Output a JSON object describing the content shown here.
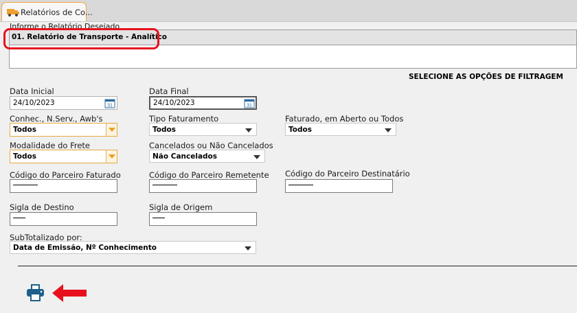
{
  "tab": {
    "title": "Relatórios de Co...",
    "icon": "truck-icon"
  },
  "report": {
    "hidden_label": "Informe o Relatório Desejado",
    "selected": "01. Relatório de Transporte - Analítico"
  },
  "filter_title": "SELECIONE AS OPÇÕES DE FILTRAGEM",
  "fields": {
    "data_inicial": {
      "label": "Data Inicial",
      "value": "24/10/2023"
    },
    "data_final": {
      "label": "Data Final",
      "value": "24/10/2023"
    },
    "conhec": {
      "label": "Conhec., N.Serv., Awb's",
      "value": "Todos"
    },
    "tipo_faturamento": {
      "label": "Tipo Faturamento",
      "value": "Todos"
    },
    "faturado": {
      "label": "Faturado, em Aberto ou Todos",
      "value": "Todos"
    },
    "modalidade": {
      "label": "Modalidade do Frete",
      "value": "Todos"
    },
    "cancelados": {
      "label": "Cancelados ou Não Cancelados",
      "value": "Não Cancelados"
    },
    "parceiro_faturado": {
      "label": "Código do Parceiro Faturado"
    },
    "parceiro_remetente": {
      "label": "Código do Parceiro Remetente"
    },
    "parceiro_destinatario": {
      "label": "Código do Parceiro Destinatário"
    },
    "sigla_destino": {
      "label": "Sigla de Destino"
    },
    "sigla_origem": {
      "label": "Sigla de Origem"
    },
    "subtotalizado": {
      "label": "SubTotalizado por:",
      "value": "Data de Emissão, Nº Conhecimento"
    }
  },
  "colors": {
    "highlight": "#e8101c",
    "printer": "#1f5f8b",
    "tab_border": "#f0a23c"
  }
}
